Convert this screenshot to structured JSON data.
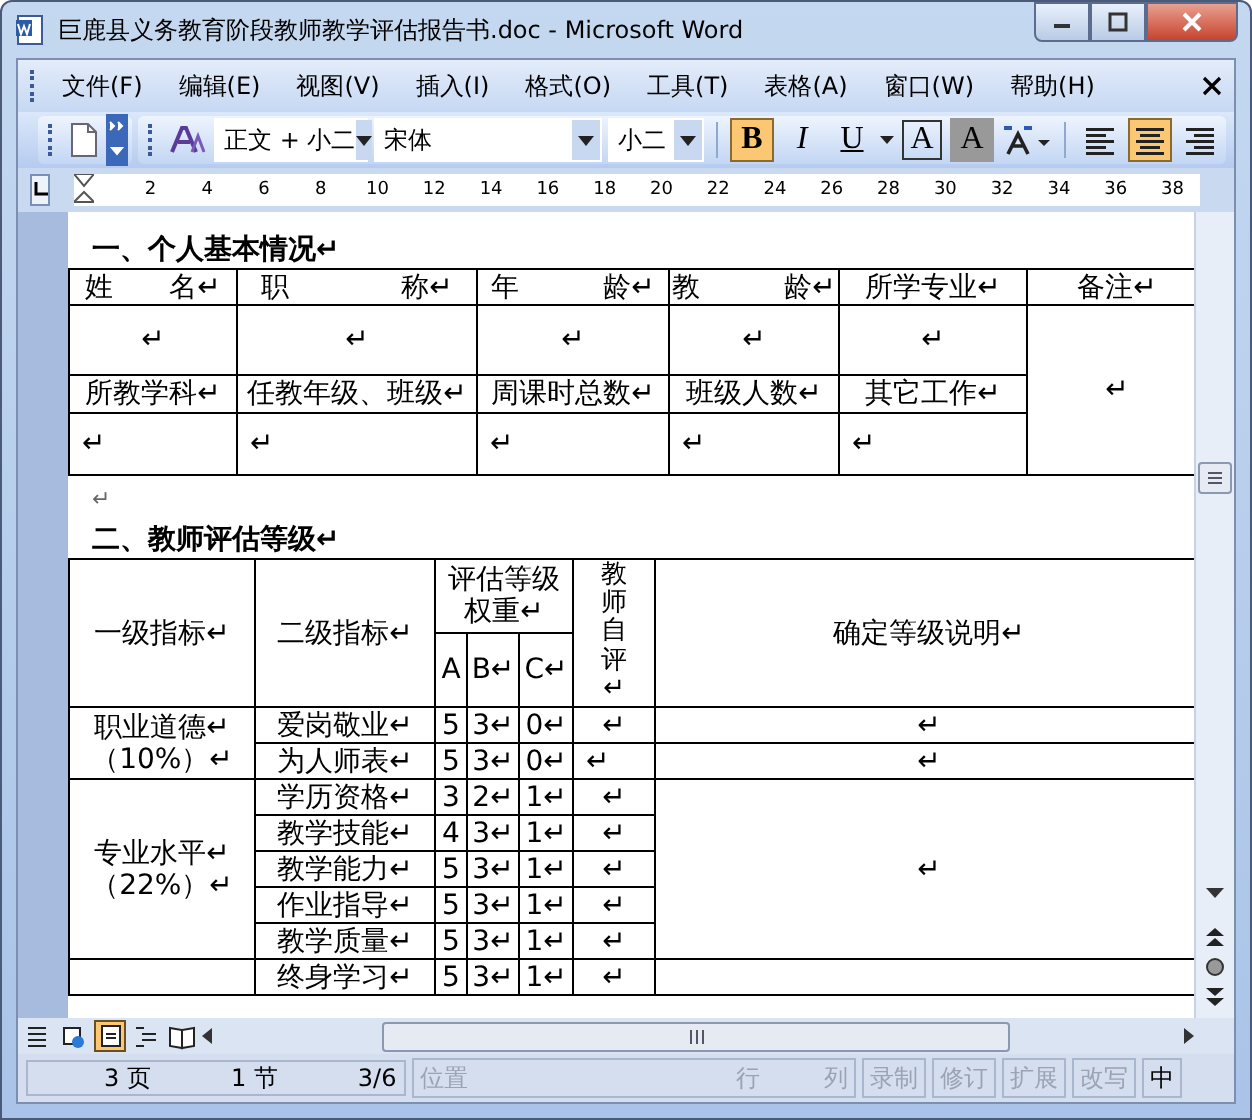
{
  "window": {
    "title": "巨鹿县义务教育阶段教师教学评估报告书.doc - Microsoft Word"
  },
  "menu": [
    "文件(F)",
    "编辑(E)",
    "视图(V)",
    "插入(I)",
    "格式(O)",
    "工具(T)",
    "表格(A)",
    "窗口(W)",
    "帮助(H)"
  ],
  "toolbar": {
    "style": "正文 + 小二",
    "font": "宋体",
    "size": "小二",
    "format_buttons": [
      {
        "label": "B",
        "kind": "bold",
        "selected": true
      },
      {
        "label": "I",
        "kind": "italic",
        "selected": false
      },
      {
        "label": "U",
        "kind": "underline",
        "selected": false
      },
      {
        "label": "A",
        "kind": "border",
        "selected": false
      },
      {
        "label": "A",
        "kind": "shading",
        "selected": false
      }
    ],
    "align_buttons": [
      {
        "kind": "left",
        "selected": false
      },
      {
        "kind": "center",
        "selected": true
      },
      {
        "kind": "right",
        "selected": false
      }
    ]
  },
  "ruler": [
    "2",
    "4",
    "6",
    "8",
    "10",
    "12",
    "14",
    "16",
    "18",
    "20",
    "22",
    "24",
    "26",
    "28",
    "30",
    "32",
    "34",
    "36",
    "38"
  ],
  "document": [
    {
      "kind": "heading",
      "text": "一、个人基本情况↵"
    },
    {
      "kind": "table",
      "rows": [
        [
          {
            "text": "姓　　名↵"
          },
          {
            "text": "职　　　　称↵"
          },
          {
            "text": "年　　　龄↵"
          },
          {
            "text": "教　　　龄↵"
          },
          {
            "text": "所学专业↵"
          },
          {
            "text": "备注↵"
          }
        ],
        [
          {
            "text": "↵"
          },
          {
            "text": "↵"
          },
          {
            "text": "↵"
          },
          {
            "text": "↵"
          },
          {
            "text": "↵"
          },
          {
            "text": "↵",
            "rowspan": 3
          }
        ],
        [
          {
            "text": "所教学科↵"
          },
          {
            "text": "任教年级、班级↵"
          },
          {
            "text": "周课时总数↵"
          },
          {
            "text": "班级人数↵"
          },
          {
            "text": "其它工作↵"
          }
        ],
        [
          {
            "text": "↵"
          },
          {
            "text": "↵"
          },
          {
            "text": "↵"
          },
          {
            "text": "↵"
          },
          {
            "text": "↵"
          }
        ]
      ]
    },
    {
      "kind": "paragraph",
      "text": "↵"
    },
    {
      "kind": "heading",
      "text": "二、教师评估等级↵"
    },
    {
      "kind": "table",
      "rows": [
        [
          {
            "text": "一级指标↵",
            "rowspan": 2
          },
          {
            "text": "二级指标↵",
            "rowspan": 2
          },
          {
            "text": "评估等级权重↵",
            "colspan": 3
          },
          {
            "text": "教师自评↵",
            "rowspan": 2
          },
          {
            "text": "确定等级说明↵",
            "rowspan": 2
          }
        ],
        [
          {
            "text": "A"
          },
          {
            "text": "B↵"
          },
          {
            "text": "C↵"
          }
        ],
        [
          {
            "lines": [
              "职业道德↵",
              "（10%）↵"
            ],
            "rowspan": 2
          },
          {
            "text": "爱岗敬业↵"
          },
          {
            "text": "5"
          },
          {
            "text": "3↵"
          },
          {
            "text": "0↵"
          },
          {
            "text": "↵"
          },
          {
            "text": "↵"
          }
        ],
        [
          {
            "text": "为人师表↵"
          },
          {
            "text": "5"
          },
          {
            "text": "3↵"
          },
          {
            "text": "0↵"
          },
          {
            "text": "↵"
          },
          {
            "text": "↵"
          }
        ],
        [
          {
            "lines": [
              "专业水平↵",
              "（22%）↵"
            ],
            "rowspan": 5
          },
          {
            "text": "学历资格↵"
          },
          {
            "text": "3"
          },
          {
            "text": "2↵"
          },
          {
            "text": "1↵"
          },
          {
            "text": "↵"
          },
          {
            "text": "↵",
            "rowspan": 5
          }
        ],
        [
          {
            "text": "教学技能↵"
          },
          {
            "text": "4"
          },
          {
            "text": "3↵"
          },
          {
            "text": "1↵"
          },
          {
            "text": "↵"
          }
        ],
        [
          {
            "text": "教学能力↵"
          },
          {
            "text": "5"
          },
          {
            "text": "3↵"
          },
          {
            "text": "1↵"
          },
          {
            "text": "↵"
          }
        ],
        [
          {
            "text": "作业指导↵"
          },
          {
            "text": "5"
          },
          {
            "text": "3↵"
          },
          {
            "text": "1↵"
          },
          {
            "text": "↵"
          }
        ],
        [
          {
            "text": "教学质量↵"
          },
          {
            "text": "5"
          },
          {
            "text": "3↵"
          },
          {
            "text": "1↵"
          },
          {
            "text": "↵"
          }
        ],
        [
          {},
          {
            "text": "终身学习↵"
          },
          {
            "text": "5"
          },
          {
            "text": "3↵"
          },
          {
            "text": "1↵"
          },
          {
            "text": "↵"
          },
          {}
        ]
      ]
    }
  ],
  "view_modes": [
    {
      "kind": "normal",
      "selected": false
    },
    {
      "kind": "web",
      "selected": false
    },
    {
      "kind": "page",
      "selected": true
    },
    {
      "kind": "outline",
      "selected": false
    },
    {
      "kind": "reading",
      "selected": false
    }
  ],
  "status_bar": {
    "page": "3 页",
    "section": "1 节",
    "pages": "3/6",
    "position": "位置",
    "line": "行",
    "column": "列",
    "modes": [
      {
        "label": "录制",
        "disabled": true
      },
      {
        "label": "修订",
        "disabled": true
      },
      {
        "label": "扩展",
        "disabled": true
      },
      {
        "label": "改写",
        "disabled": true
      },
      {
        "label": "中",
        "disabled": false
      }
    ]
  }
}
